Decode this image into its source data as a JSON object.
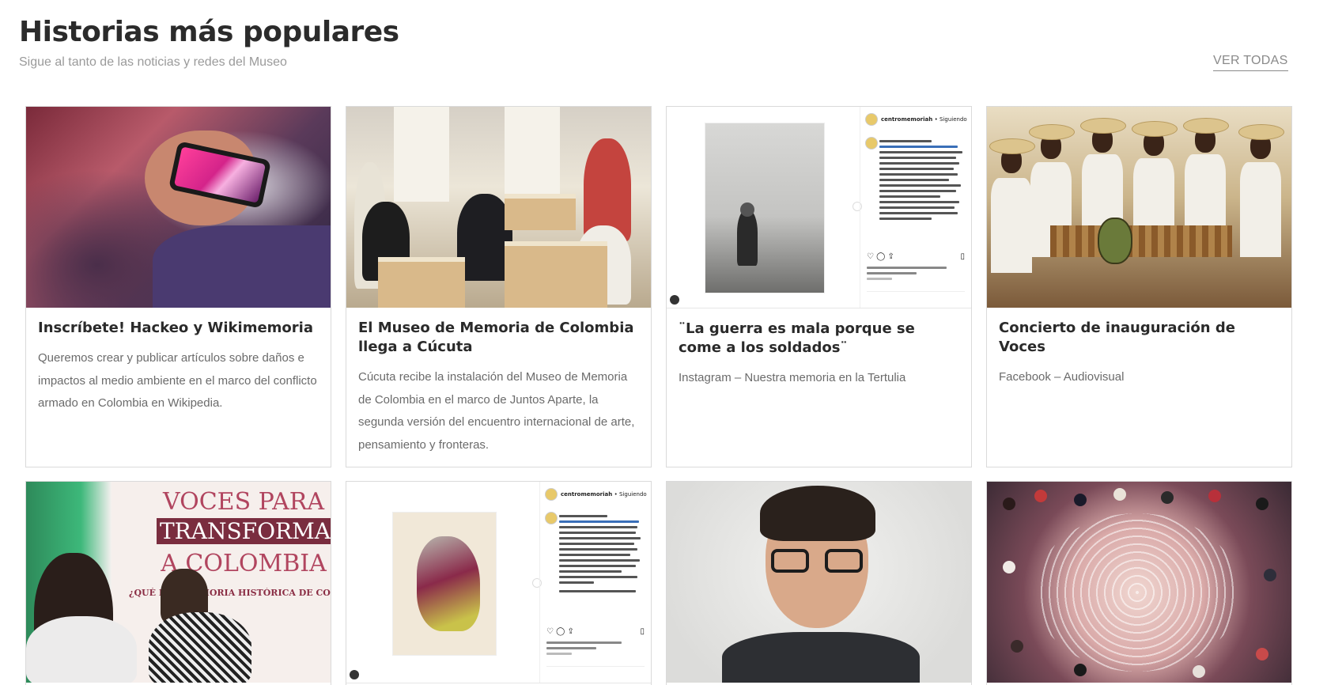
{
  "header": {
    "title": "Historias más populares",
    "subtitle": "Sigue al tanto de las noticias y redes del Museo",
    "view_all": "VER TODAS"
  },
  "cards": [
    {
      "title": "Inscríbete! Hackeo y Wikimemoria",
      "text": "Queremos crear y  publicar artículos sobre daños e impactos al medio ambiente en el marco del conflicto armado en Colombia en Wikipedia."
    },
    {
      "title": "El Museo de Memoria de Colombia llega a Cúcuta",
      "text": "Cúcuta recibe la instalación del Museo de Memoria de Colombia en el marco de Juntos Aparte, la segunda versión del encuentro internacional de arte, pensamiento y fronteras."
    },
    {
      "title": "¨La guerra es mala porque se come a los soldados¨",
      "text": "Instagram – Nuestra memoria en la Tertulia"
    },
    {
      "title": "Concierto de inauguración de Voces",
      "text": "Facebook – Audiovisual"
    }
  ],
  "thumbs": {
    "insta_account": "centromemoriah",
    "insta_follow": "• Siguiendo",
    "voces_line1": "VOCES PARA",
    "voces_line2": "TRANSFORMAR",
    "voces_line3": "A COLOMBIA",
    "voces_line4": "¿QUÉ ES... MEMORIA HISTÓRICA DE COLOM"
  },
  "colors": {
    "title": "#2b2b2b",
    "subtitle": "#9a9a9a",
    "card_border": "#dadada",
    "card_text": "#6b6b6b"
  }
}
